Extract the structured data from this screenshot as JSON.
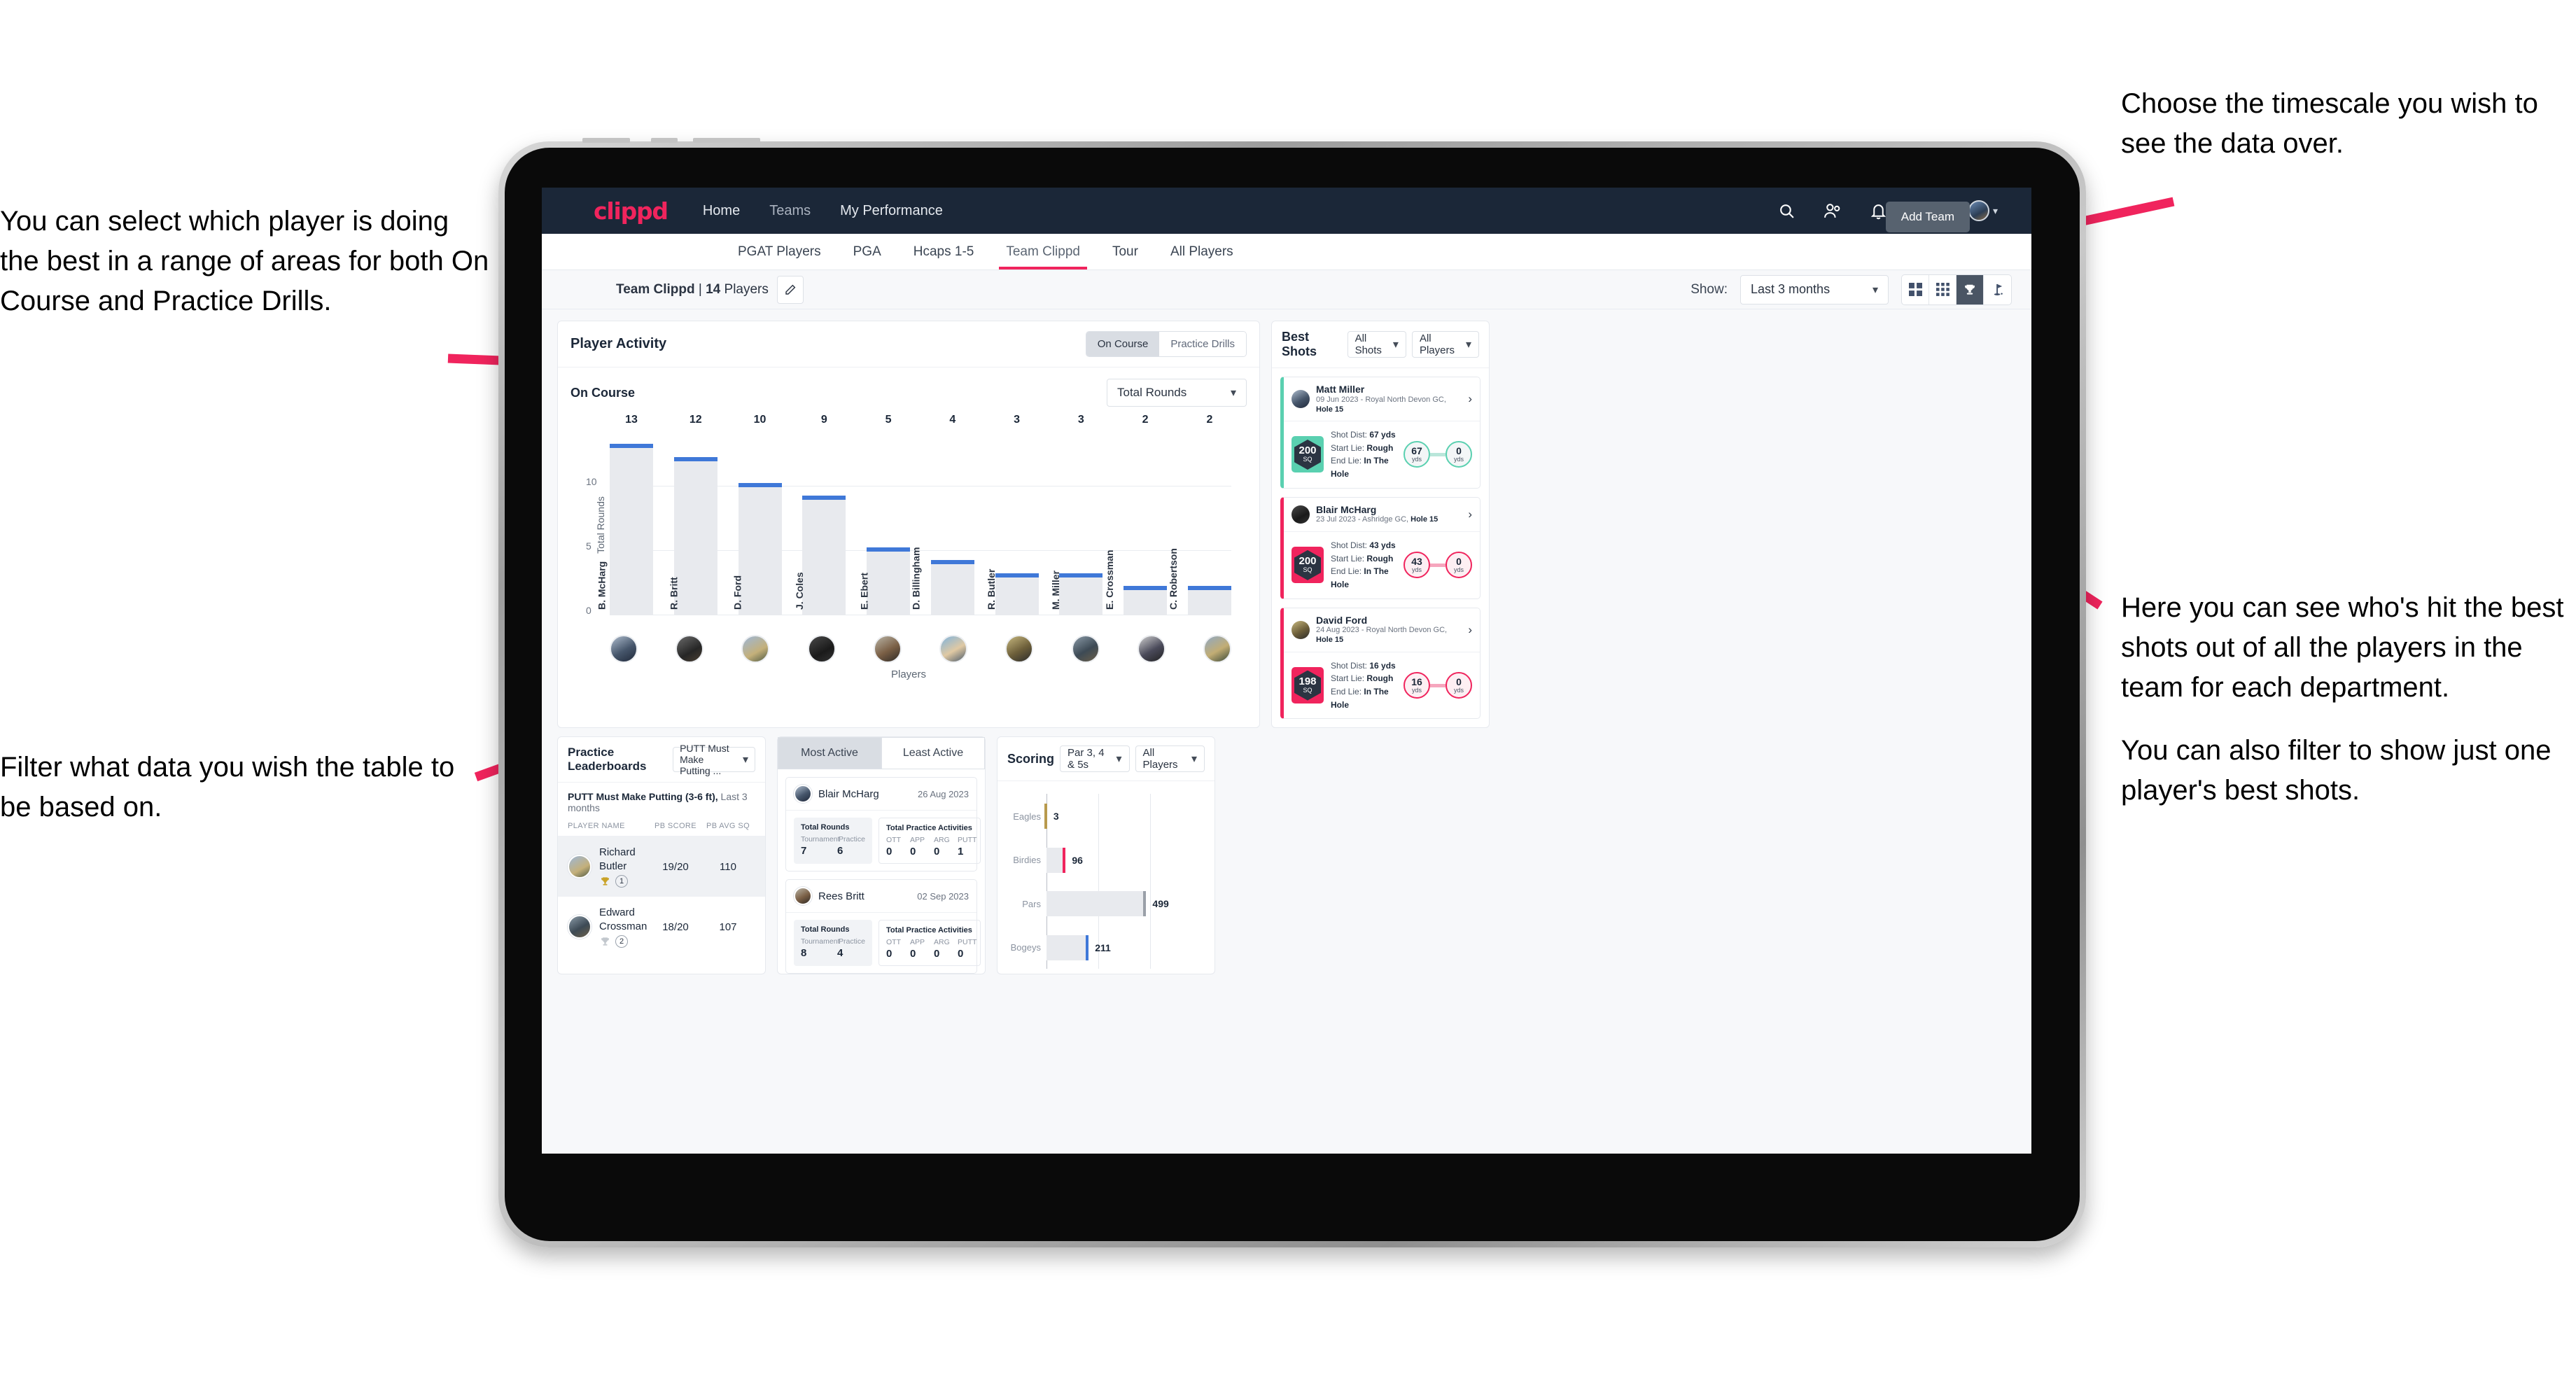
{
  "annotations": {
    "left_top": "You can select which player is doing the best in a range of areas for both On Course and Practice Drills.",
    "left_bottom": "Filter what data you wish the table to be based on.",
    "right_top": "Choose the timescale you wish to see the data over.",
    "right_mid": "Here you can see who's hit the best shots out of all the players in the team for each department.",
    "right_bottom": "You can also filter to show just one player's best shots."
  },
  "navbar": {
    "logo": "clippd",
    "links": [
      {
        "label": "Home",
        "muted": false
      },
      {
        "label": "Teams",
        "muted": true
      },
      {
        "label": "My Performance",
        "muted": false
      }
    ],
    "icons": [
      "search-icon",
      "people-icon",
      "bell-icon",
      "plus-circle-icon",
      "avatar-icon"
    ]
  },
  "tabs": [
    {
      "label": "PGAT Players",
      "active": false
    },
    {
      "label": "PGA",
      "active": false
    },
    {
      "label": "Hcaps 1-5",
      "active": false
    },
    {
      "label": "Team Clippd",
      "active": true
    },
    {
      "label": "Tour",
      "active": false
    },
    {
      "label": "All Players",
      "active": false
    }
  ],
  "add_team_button": "Add Team",
  "subbar": {
    "team_name": "Team Clippd",
    "separator": " | ",
    "player_count": "14",
    "players_word": " Players",
    "edit_icon": "pencil-icon",
    "show_label": "Show:",
    "timescale_value": "Last 3 months",
    "view_toggles": [
      {
        "icon": "grid-2x2-icon",
        "active": false
      },
      {
        "icon": "grid-3x3-icon",
        "active": false
      },
      {
        "icon": "trophy-icon",
        "active": true
      },
      {
        "icon": "flag-icon",
        "active": false
      }
    ]
  },
  "player_activity": {
    "title": "Player Activity",
    "segments": [
      {
        "label": "On Course",
        "active": true
      },
      {
        "label": "Practice Drills",
        "active": false
      }
    ],
    "sub_label": "On Course",
    "metric_select": "Total Rounds"
  },
  "chart_data": [
    {
      "type": "bar",
      "title": "Player Activity - On Course",
      "ylabel": "Total Rounds",
      "xlabel": "Players",
      "ylim": [
        0,
        14
      ],
      "yticks": [
        0,
        5,
        10
      ],
      "grid": true,
      "categories": [
        "B. McHarg",
        "R. Britt",
        "D. Ford",
        "J. Coles",
        "E. Ebert",
        "D. Billingham",
        "R. Butler",
        "M. Miller",
        "E. Crossman",
        "C. Robertson"
      ],
      "values": [
        13,
        12,
        10,
        9,
        5,
        4,
        3,
        3,
        2,
        2
      ],
      "bar_color": "#e8eaee",
      "cap_color": "#3f78d8"
    },
    {
      "type": "bar",
      "title": "Scoring",
      "orientation": "horizontal",
      "categories": [
        "Eagles",
        "Birdies",
        "Pars",
        "Bogeys"
      ],
      "values": [
        3,
        96,
        499,
        211
      ],
      "xlim": [
        0,
        620
      ],
      "tip_colors": [
        "#b89a4d",
        "#f0245d",
        "#9aa0a8",
        "#3f78d8"
      ],
      "grid": true
    }
  ],
  "best_shots": {
    "title": "Best Shots",
    "filter_shots": "All Shots",
    "filter_players": "All Players",
    "shots": [
      {
        "player": "Matt Miller",
        "meta_date": "09 Jun 2023 - Royal North Devon GC, ",
        "meta_hole": "Hole 15",
        "badge_value": "200",
        "badge_unit": "SQ",
        "accent": "#5ad0b0",
        "shot_dist_label": "Shot Dist: ",
        "shot_dist": "67 yds",
        "start_lie_label": "Start Lie: ",
        "start_lie": "Rough",
        "end_lie_label": "End Lie: ",
        "end_lie": "In The Hole",
        "from_value": "67",
        "from_unit": "yds",
        "to_value": "0",
        "to_unit": "yds"
      },
      {
        "player": "Blair McHarg",
        "meta_date": "23 Jul 2023 - Ashridge GC, ",
        "meta_hole": "Hole 15",
        "badge_value": "200",
        "badge_unit": "SQ",
        "accent": "#f0245d",
        "shot_dist_label": "Shot Dist: ",
        "shot_dist": "43 yds",
        "start_lie_label": "Start Lie: ",
        "start_lie": "Rough",
        "end_lie_label": "End Lie: ",
        "end_lie": "In The Hole",
        "from_value": "43",
        "from_unit": "yds",
        "to_value": "0",
        "to_unit": "yds"
      },
      {
        "player": "David Ford",
        "meta_date": "24 Aug 2023 - Royal North Devon GC, ",
        "meta_hole": "Hole 15",
        "badge_value": "198",
        "badge_unit": "SQ",
        "accent": "#f0245d",
        "shot_dist_label": "Shot Dist: ",
        "shot_dist": "16 yds",
        "start_lie_label": "Start Lie: ",
        "start_lie": "Rough",
        "end_lie_label": "End Lie: ",
        "end_lie": "In The Hole",
        "from_value": "16",
        "from_unit": "yds",
        "to_value": "0",
        "to_unit": "yds"
      }
    ]
  },
  "practice_leaderboards": {
    "title": "Practice Leaderboards",
    "drill_select": "PUTT Must Make Putting ...",
    "subtitle_bold": "PUTT Must Make Putting (3-6 ft),",
    "subtitle_light": " Last 3 months",
    "columns": [
      "PLAYER NAME",
      "PB SCORE",
      "PB AVG SQ"
    ],
    "rows": [
      {
        "name": "Richard Butler",
        "rank": "1",
        "trophy": "gold",
        "pb_score": "19/20",
        "pb_avg_sq": "110",
        "highlighted": true
      },
      {
        "name": "Edward Crossman",
        "rank": "2",
        "trophy": "silver",
        "pb_score": "18/20",
        "pb_avg_sq": "107",
        "highlighted": false
      }
    ]
  },
  "activity": {
    "tabs": [
      {
        "label": "Most Active",
        "active": true
      },
      {
        "label": "Least Active",
        "active": false
      }
    ],
    "rounds_title": "Total Rounds",
    "rounds_headers": [
      "Tournament",
      "Practice"
    ],
    "practice_title": "Total Practice Activities",
    "practice_headers": [
      "OTT",
      "APP",
      "ARG",
      "PUTT"
    ],
    "cards": [
      {
        "name": "Blair McHarg",
        "date": "26 Aug 2023",
        "tournament": "7",
        "practice": "6",
        "ott": "0",
        "app": "0",
        "arg": "0",
        "putt": "1"
      },
      {
        "name": "Rees Britt",
        "date": "02 Sep 2023",
        "tournament": "8",
        "practice": "4",
        "ott": "0",
        "app": "0",
        "arg": "0",
        "putt": "0"
      }
    ]
  },
  "scoring": {
    "title": "Scoring",
    "filter_par": "Par 3, 4 & 5s",
    "filter_players": "All Players"
  },
  "colors": {
    "brand_pink": "#f0245d",
    "navy": "#1b2738",
    "teal": "#5ad0b0",
    "blue": "#3f78d8"
  }
}
